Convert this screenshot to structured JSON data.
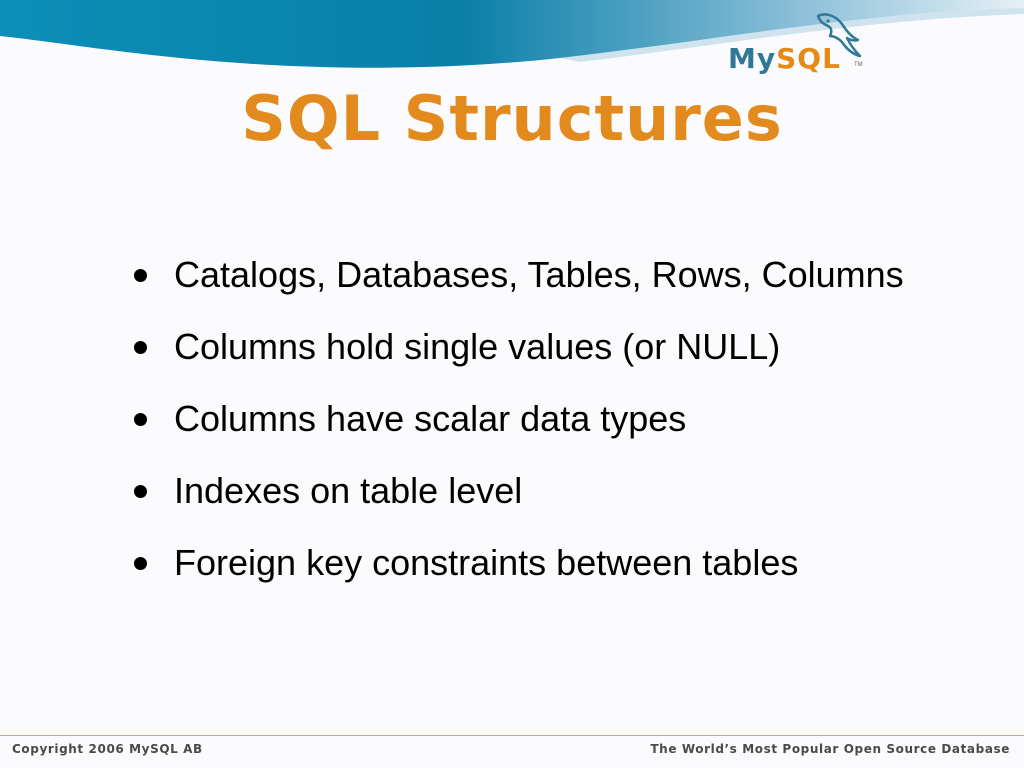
{
  "logo": {
    "my": "My",
    "sql": "SQL",
    "tm": "TM"
  },
  "title": "SQL Structures",
  "bullets": [
    "Catalogs, Databases, Tables, Rows, Columns",
    "Columns hold single values (or NULL)",
    "Columns have scalar data types",
    "Indexes on table level",
    "Foreign key constraints between tables"
  ],
  "footer": {
    "left": "Copyright 2006 MySQL AB",
    "right": "The World’s Most Popular Open Source Database"
  },
  "colors": {
    "title": "#e38a1f",
    "wave_dark": "#0a7fa8",
    "wave_light": "#cfe3ef",
    "logo_blue": "#2f7897",
    "logo_orange": "#e58a14"
  }
}
